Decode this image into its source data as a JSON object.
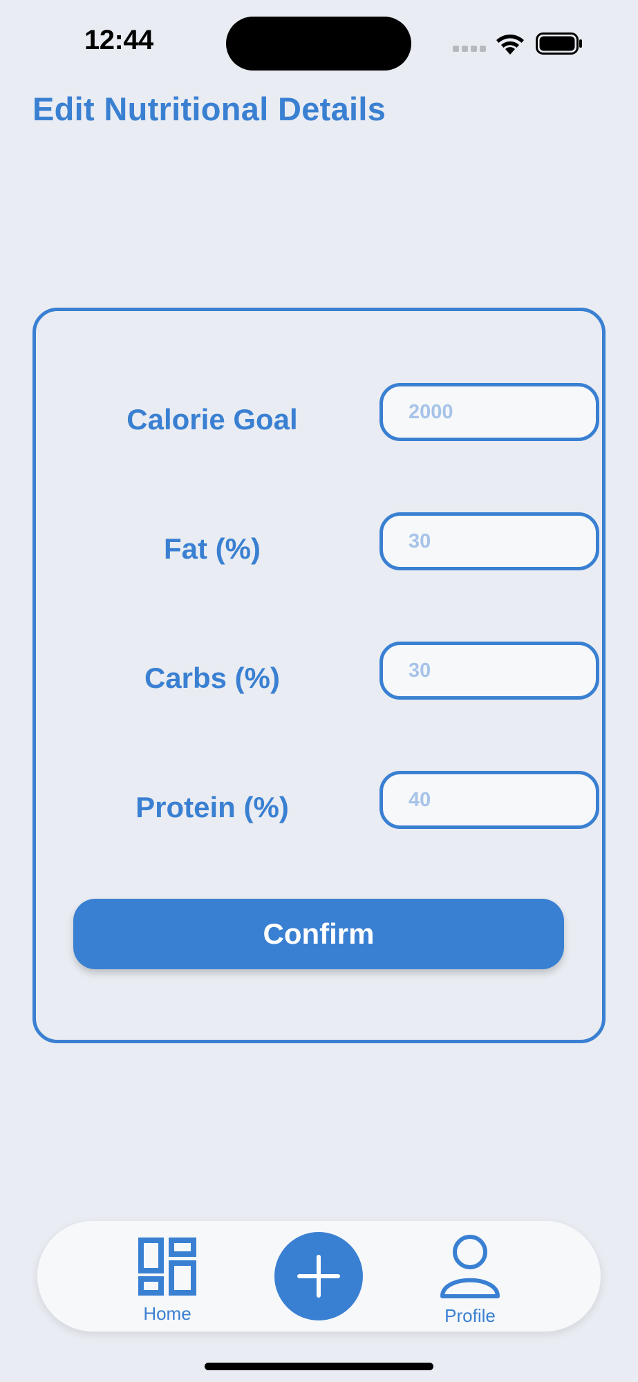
{
  "status_bar": {
    "time": "12:44"
  },
  "header": {
    "title": "Edit Nutritional Details"
  },
  "form": {
    "fields": [
      {
        "label": "Calorie Goal",
        "placeholder": "2000"
      },
      {
        "label": "Fat (%)",
        "placeholder": "30"
      },
      {
        "label": "Carbs (%)",
        "placeholder": "30"
      },
      {
        "label": "Protein (%)",
        "placeholder": "40"
      }
    ],
    "confirm_label": "Confirm"
  },
  "tab_bar": {
    "home_label": "Home",
    "profile_label": "Profile",
    "home_icon": "grid-icon",
    "add_icon": "plus-icon",
    "profile_icon": "person-icon"
  },
  "colors": {
    "accent": "#3a80d2",
    "background": "#e9ecf2",
    "field_background": "#f6f8fa",
    "placeholder": "#a7c3e8"
  }
}
